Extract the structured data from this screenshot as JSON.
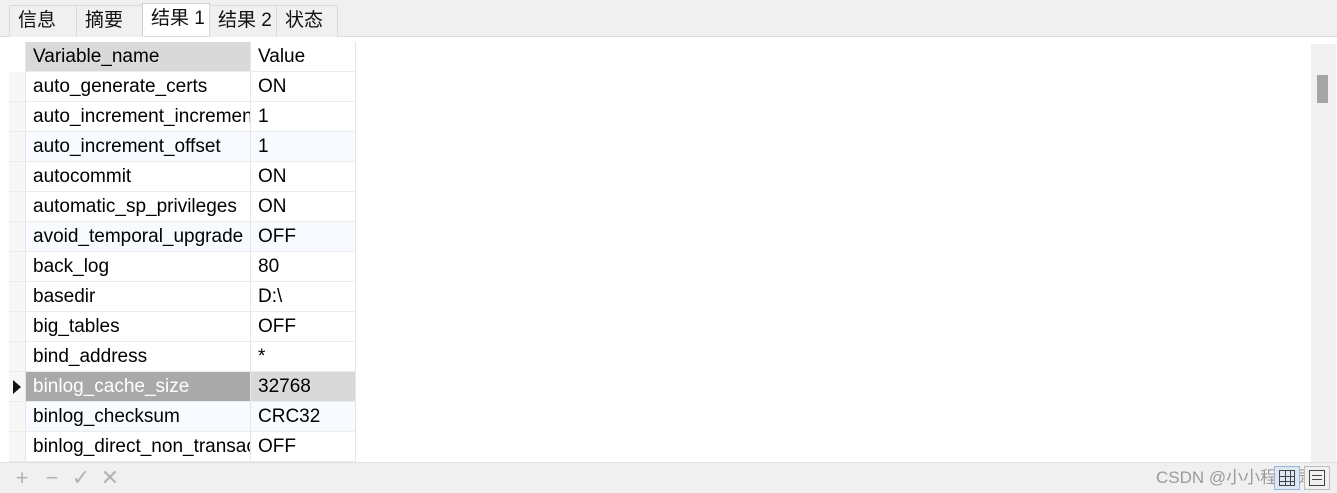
{
  "tabs": [
    {
      "label": "信息",
      "active": false
    },
    {
      "label": "摘要",
      "active": false
    },
    {
      "label": "结果 1",
      "active": true
    },
    {
      "label": "结果 2",
      "active": false
    },
    {
      "label": "状态",
      "active": false
    }
  ],
  "table": {
    "columns": [
      "Variable_name",
      "Value"
    ],
    "rows": [
      {
        "name": "auto_generate_certs",
        "value": "ON"
      },
      {
        "name": "auto_increment_increment",
        "value": "1"
      },
      {
        "name": "auto_increment_offset",
        "value": "1"
      },
      {
        "name": "autocommit",
        "value": "ON"
      },
      {
        "name": "automatic_sp_privileges",
        "value": "ON"
      },
      {
        "name": "avoid_temporal_upgrade",
        "value": "OFF"
      },
      {
        "name": "back_log",
        "value": "80"
      },
      {
        "name": "basedir",
        "value": "D:\\"
      },
      {
        "name": "big_tables",
        "value": "OFF"
      },
      {
        "name": "bind_address",
        "value": "*"
      },
      {
        "name": "binlog_cache_size",
        "value": "32768"
      },
      {
        "name": "binlog_checksum",
        "value": "CRC32"
      },
      {
        "name": "binlog_direct_non_transactional_updates",
        "value": "OFF"
      }
    ],
    "selected_row": 10
  },
  "toolbar": {
    "add": "+",
    "remove": "−",
    "apply": "✓",
    "cancel": "✕",
    "watermark": "CSDN @小小程序员"
  },
  "icons": {
    "selected_row": "row-pointer-icon",
    "grid_view": "grid-view-icon",
    "form_view": "form-view-icon"
  }
}
